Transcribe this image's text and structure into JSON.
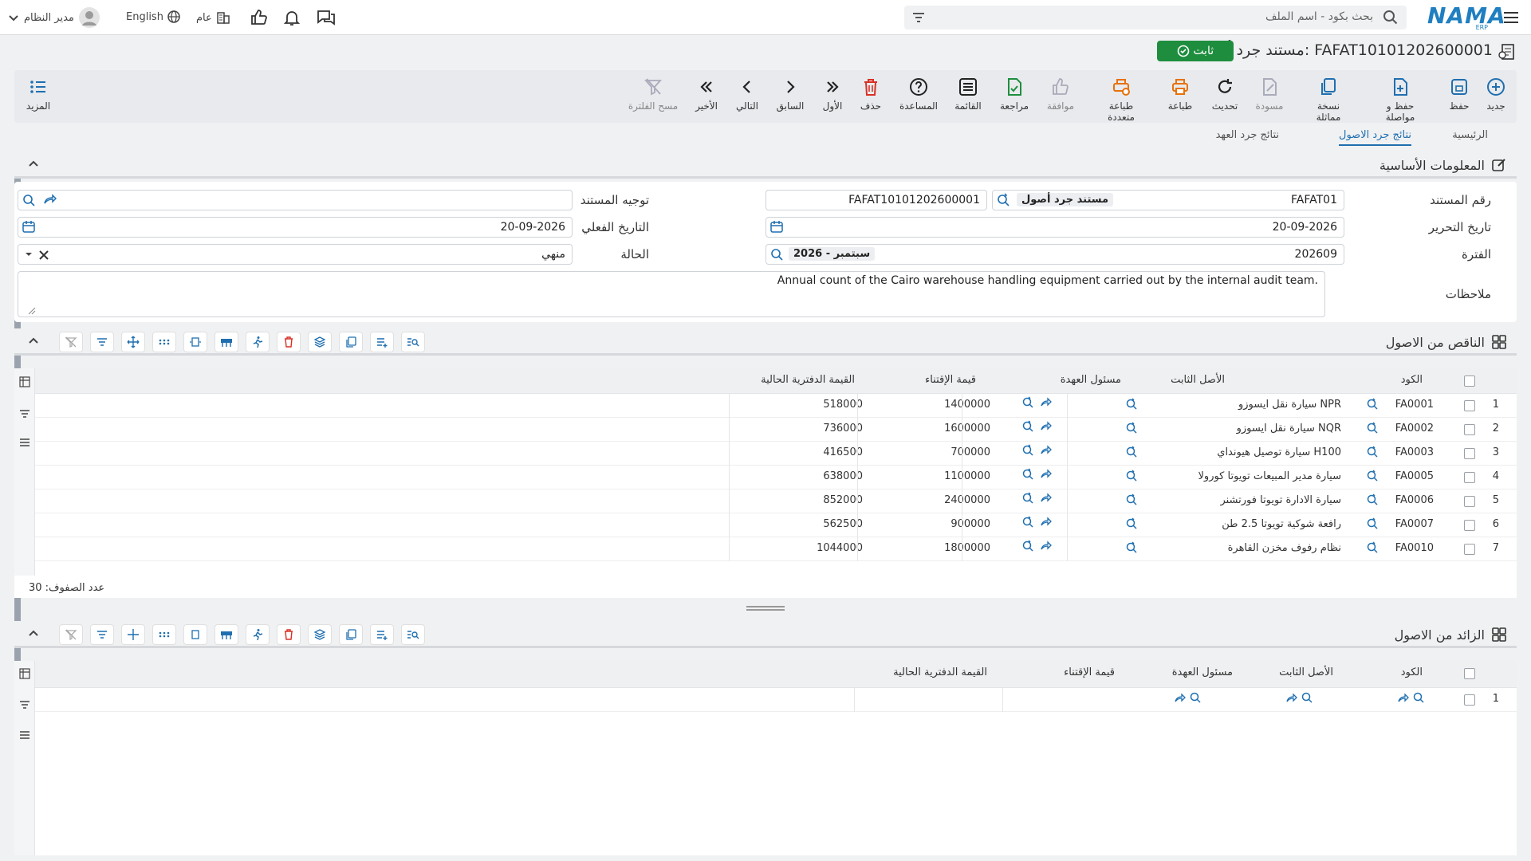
{
  "topbar": {
    "search_placeholder": "بحث بكود - اسم الملف",
    "logo_text": "NAMA",
    "logo_sub": "ERP",
    "user_name": "مدير النظام",
    "language": "English",
    "general": "عام"
  },
  "title": {
    "text": "مستند جرد أصول: FAFAT10101202600001",
    "status": "ثابت"
  },
  "toolbar": {
    "new": "جديد",
    "save": "حفظ",
    "save_continue": "حفظ و مواصلة",
    "copy": "نسخة مماثلة",
    "draft": "مسودة",
    "refresh": "تحديث",
    "print": "طباعة",
    "multi_print": "طباعة متعددة",
    "approve": "موافقة",
    "review": "مراجعة",
    "list": "القائمة",
    "help": "المساعدة",
    "delete": "حذف",
    "first": "الأول",
    "prev": "السابق",
    "next": "التالي",
    "last": "الأخير",
    "clear_filter": "مسح الفلترة",
    "more": "المزيد"
  },
  "tabs": [
    "الرئيسية",
    "نتائج جرد الاصول",
    "نتائج جرد العهد"
  ],
  "basic": {
    "section_title": "المعلومات الأساسية",
    "doc_no_label": "رقم المستند",
    "doc_no_value": "FAFAT01",
    "doc_type_chip": "مستند جرد أصول",
    "doc_full_no": "FAFAT10101202600001",
    "doc_direction_label": "توجيه المستند",
    "write_date_label": "تاريخ التحرير",
    "write_date": "20-09-2026",
    "actual_date_label": "التاريخ الفعلي",
    "actual_date": "20-09-2026",
    "period_label": "الفترة",
    "period_value": "202609",
    "period_chip": "2026 - سبتمبر",
    "status_label": "الحالة",
    "status_value": "منهي",
    "notes_label": "ملاحظات",
    "notes_value": "Annual count of the Cairo warehouse handling equipment carried out by the internal audit team."
  },
  "shortage": {
    "section_title": "الناقص من الاصول",
    "columns": {
      "code": "الكود",
      "asset": "الأصل الثابت",
      "custodian": "مسئول العهدة",
      "acq_value": "قيمة الإقتناء",
      "book_value": "القيمة الدفترية الحالية"
    },
    "rows": [
      {
        "n": "1",
        "code": "FA0001",
        "asset": "سيارة نقل ايسوزو NPR",
        "acq": "1400000",
        "book": "518000"
      },
      {
        "n": "2",
        "code": "FA0002",
        "asset": "سيارة نقل ايسوزو NQR",
        "acq": "1600000",
        "book": "736000"
      },
      {
        "n": "3",
        "code": "FA0003",
        "asset": "سيارة توصيل هيونداي H100",
        "acq": "700000",
        "book": "416500"
      },
      {
        "n": "4",
        "code": "FA0005",
        "asset": "سيارة مدير المبيعات تويوتا كورولا",
        "acq": "1100000",
        "book": "638000"
      },
      {
        "n": "5",
        "code": "FA0006",
        "asset": "سيارة الادارة تويوتا فورتشنر",
        "acq": "2400000",
        "book": "852000"
      },
      {
        "n": "6",
        "code": "FA0007",
        "asset": "رافعة شوكية تويوتا 2.5 طن",
        "acq": "900000",
        "book": "562500"
      },
      {
        "n": "7",
        "code": "FA0010",
        "asset": "نظام رفوف مخزن القاهرة",
        "acq": "1800000",
        "book": "1044000"
      }
    ],
    "row_count": "عدد الصفوف: 30"
  },
  "surplus": {
    "section_title": "الزائد من الاصول",
    "columns": {
      "code": "الكود",
      "asset": "الأصل الثابت",
      "custodian": "مسئول العهدة",
      "acq_value": "قيمة الإقتناء",
      "book_value": "القيمة الدفترية الحالية"
    },
    "rows": [
      {
        "n": "1"
      }
    ]
  },
  "colors": {
    "accent": "#1f6fb0",
    "status_green": "#1e8e3e",
    "delete_red": "#d93025",
    "print_orange": "#e8710a"
  }
}
